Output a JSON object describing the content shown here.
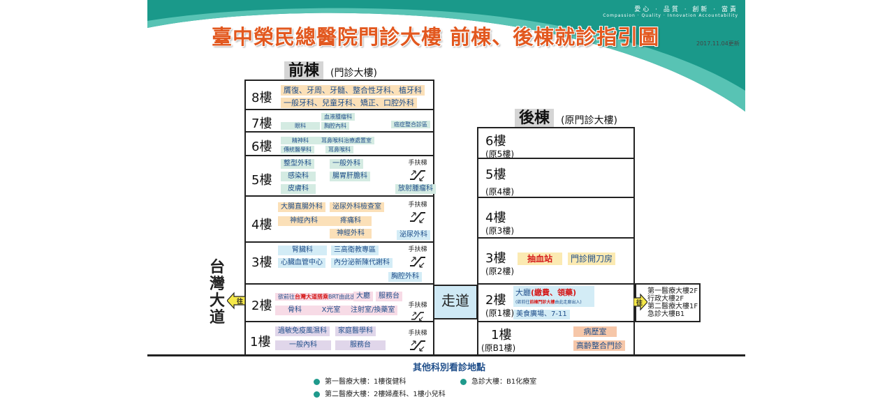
{
  "header": {
    "slogan_zh": "愛心 · 品質 · 創新 · 當責",
    "slogan_en": "Compassion · Quality · Innovation Accountability",
    "title": "臺中榮民總醫院門診大樓 前棟、後棟就診指引圖",
    "date": "2017.11.04更新"
  },
  "front": {
    "name": "前棟",
    "subtitle": "(門診大樓)",
    "floors": {
      "f8": {
        "label": "8樓",
        "line1": "贋復、牙周、牙髓、整合性牙科、植牙科",
        "line2": "一般牙科、兒童牙科、矯正、口腔外科"
      },
      "f7": {
        "label": "7樓",
        "a": "血液腫瘤科",
        "b": "眼科",
        "c": "胸腔內科",
        "d": "癌症整合診區"
      },
      "f6": {
        "label": "6樓",
        "a": "精神科",
        "b": "耳鼻喉科治療處置室",
        "c": "傳統醫學科",
        "d": "耳鼻喉科"
      },
      "f5": {
        "label": "5樓",
        "a": "整型外科",
        "b": "一般外科",
        "c": "感染科",
        "d": "腸胃肝膽科",
        "e": "皮膚科",
        "f": "放射腫瘤科",
        "esc": "手扶梯"
      },
      "f4": {
        "label": "4樓",
        "a": "大腸直腸外科",
        "b": "泌尿外科檢查室",
        "c": "神經內科",
        "d": "疼痛科",
        "e": "神經外科",
        "f": "泌尿外科",
        "esc": "手扶梯"
      },
      "f3": {
        "label": "3樓",
        "a": "腎臟科",
        "b": "三高衛教專區",
        "c": "心臟血管中心",
        "d": "內分泌新陳代謝科",
        "e": "胸腔外科",
        "esc": "手扶梯"
      },
      "f2": {
        "label": "2樓",
        "note_pre": "欲前往",
        "note_red": "台灣大道搭乘",
        "note_post": "BRT由此出入",
        "a": "大廳",
        "b": "服務台",
        "c": "骨科",
        "d": "X光室",
        "e": "注射室/換藥室",
        "esc": "手扶梯"
      },
      "f1": {
        "label": "1樓",
        "a": "過敏免疫風濕科",
        "b": "家庭醫學科",
        "c": "一般內科",
        "d": "服務台",
        "esc": "手扶梯"
      }
    }
  },
  "back": {
    "name": "後棟",
    "subtitle": "(原門診大樓)",
    "floors": {
      "f6": {
        "label": "6樓",
        "orig": "(原5樓)"
      },
      "f5": {
        "label": "5樓",
        "orig": "(原4樓)"
      },
      "f4": {
        "label": "4樓",
        "orig": "(原3樓)"
      },
      "f3": {
        "label": "3樓",
        "orig": "(原2樓)",
        "a": "抽血站",
        "b": "門診開刀房"
      },
      "f2": {
        "label": "2樓",
        "orig": "(原1樓)",
        "hall": "大廳",
        "hall_red": "(繳費、領藥)",
        "note_pre": "(欲前往",
        "note_red": "前棟門診大樓",
        "note_post": "由此走廊出入)",
        "mall": "美食廣場、7-11"
      },
      "f1": {
        "label": "1樓",
        "orig": "(原B1樓)",
        "a": "病歷室",
        "b": "高齡整合門診"
      }
    }
  },
  "corridor": "走道",
  "road": "台灣大道",
  "to_label": "往",
  "right_box": [
    "第一醫療大樓2F",
    "行政大樓2F",
    "第二醫療大樓1F",
    "急診大樓B1"
  ],
  "footer": {
    "title": "其他科別看診地點",
    "items": [
      "第一醫療大樓：1樓復健科",
      "急診大樓：B1化療室",
      "第二醫療大樓：2樓婦產科、1樓小兒科"
    ]
  },
  "colors": {
    "accent_teal": "#1f9a8c",
    "title_orange": "#e2581f",
    "text_blue": "#1f4e8a",
    "highlight_red": "#d51a1a"
  }
}
